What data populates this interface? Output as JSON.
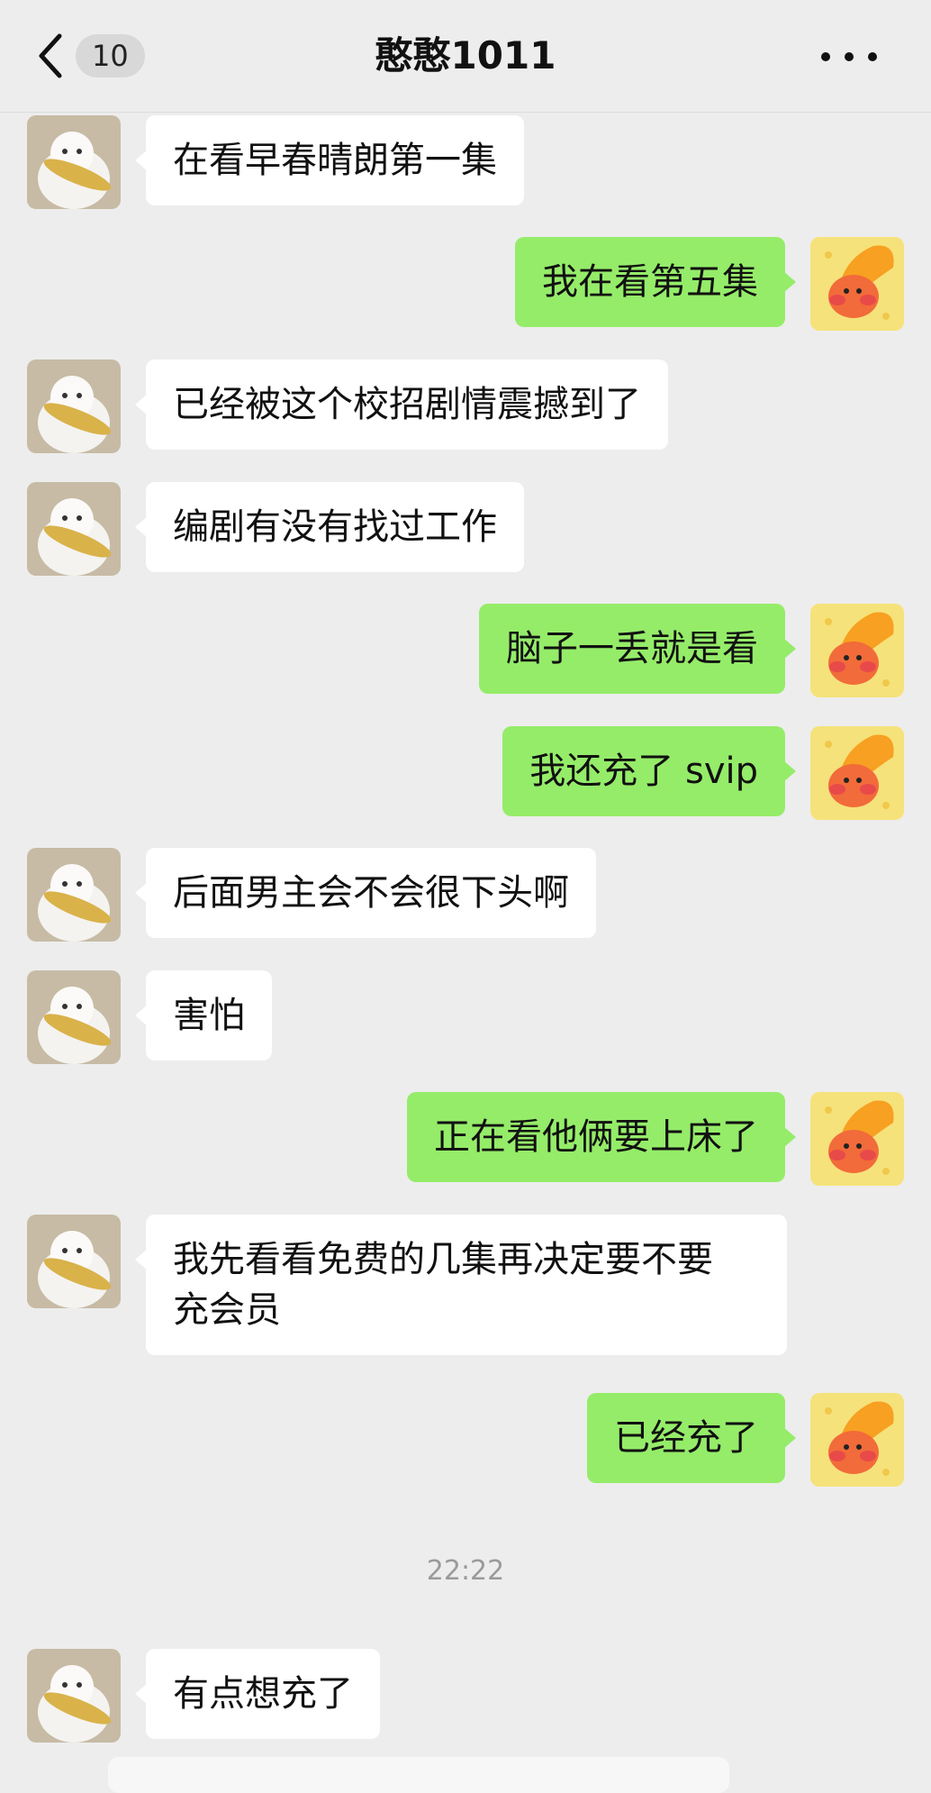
{
  "header": {
    "back_icon": "chevron-left-icon",
    "unread_count": "10",
    "title": "憨憨1011",
    "more_icon": "more-horizontal-icon"
  },
  "contact_avatar": "white-kitten-with-fish-toy",
  "self_avatar": "orange-cartoon-sticker",
  "messages": [
    {
      "side": "left",
      "text": "在看早春晴朗第一集"
    },
    {
      "side": "right",
      "text": "我在看第五集"
    },
    {
      "side": "left",
      "text": "已经被这个校招剧情震撼到了"
    },
    {
      "side": "left",
      "text": "编剧有没有找过工作"
    },
    {
      "side": "right",
      "text": "脑子一丢就是看"
    },
    {
      "side": "right",
      "text": "我还充了 svip"
    },
    {
      "side": "left",
      "text": "后面男主会不会很下头啊"
    },
    {
      "side": "left",
      "text": "害怕"
    },
    {
      "side": "right",
      "text": "正在看他俩要上床了"
    },
    {
      "side": "left",
      "text": "我先看看免费的几集再决定要不要\n充会员"
    },
    {
      "side": "right",
      "text": "已经充了"
    },
    {
      "side": "left",
      "text": "有点想充了"
    }
  ],
  "timestamp": "22:22"
}
